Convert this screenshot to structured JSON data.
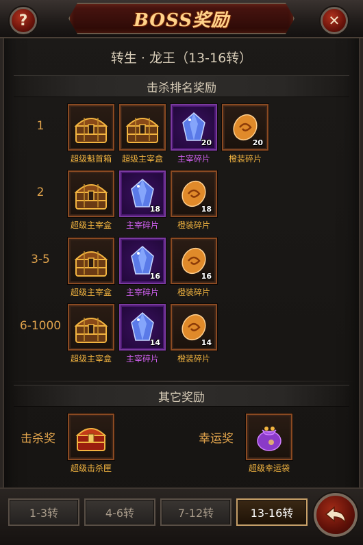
{
  "window": {
    "title": "BOSS奖励"
  },
  "header": {
    "subtitle": "转生 · 龙王（13-16转）",
    "kill_rank_section": "击杀排名奖励",
    "other_section": "其它奖励"
  },
  "buttons": {
    "help": "?",
    "close": "✕"
  },
  "ranks": [
    {
      "label": "1",
      "items": [
        {
          "name": "超级魁首箱",
          "icon": "treasure-chest-icon",
          "count": "",
          "quality": "gold"
        },
        {
          "name": "超级主宰盒",
          "icon": "treasure-chest-icon",
          "count": "",
          "quality": "gold"
        },
        {
          "name": "主宰碎片",
          "icon": "blue-crystal-icon",
          "count": "20",
          "quality": "purple"
        },
        {
          "name": "橙装碎片",
          "icon": "orange-shard-icon",
          "count": "20",
          "quality": "gold"
        }
      ]
    },
    {
      "label": "2",
      "items": [
        {
          "name": "超级主宰盒",
          "icon": "treasure-chest-icon",
          "count": "",
          "quality": "gold"
        },
        {
          "name": "主宰碎片",
          "icon": "blue-crystal-icon",
          "count": "18",
          "quality": "purple"
        },
        {
          "name": "橙装碎片",
          "icon": "orange-shard-icon",
          "count": "18",
          "quality": "gold"
        }
      ]
    },
    {
      "label": "3-5",
      "items": [
        {
          "name": "超级主宰盒",
          "icon": "treasure-chest-icon",
          "count": "",
          "quality": "gold"
        },
        {
          "name": "主宰碎片",
          "icon": "blue-crystal-icon",
          "count": "16",
          "quality": "purple"
        },
        {
          "name": "橙装碎片",
          "icon": "orange-shard-icon",
          "count": "16",
          "quality": "gold"
        }
      ]
    },
    {
      "label": "6-1000",
      "items": [
        {
          "name": "超级主宰盒",
          "icon": "treasure-chest-icon",
          "count": "",
          "quality": "gold"
        },
        {
          "name": "主宰碎片",
          "icon": "blue-crystal-icon",
          "count": "14",
          "quality": "purple"
        },
        {
          "name": "橙装碎片",
          "icon": "orange-shard-icon",
          "count": "14",
          "quality": "gold"
        }
      ]
    }
  ],
  "other_rewards": {
    "kill": {
      "label": "击杀奖",
      "item_name": "超级击杀匣",
      "icon": "red-chest-icon"
    },
    "lucky": {
      "label": "幸运奖",
      "item_name": "超级幸运袋",
      "icon": "purple-bag-icon"
    }
  },
  "tabs": [
    {
      "label": "1-3转",
      "active": false
    },
    {
      "label": "4-6转",
      "active": false
    },
    {
      "label": "7-12转",
      "active": false
    },
    {
      "label": "13-16转",
      "active": true
    }
  ],
  "colors": {
    "accent_gold": "#f2b440",
    "accent_purple": "#d060f0",
    "title": "#ffd38a"
  }
}
